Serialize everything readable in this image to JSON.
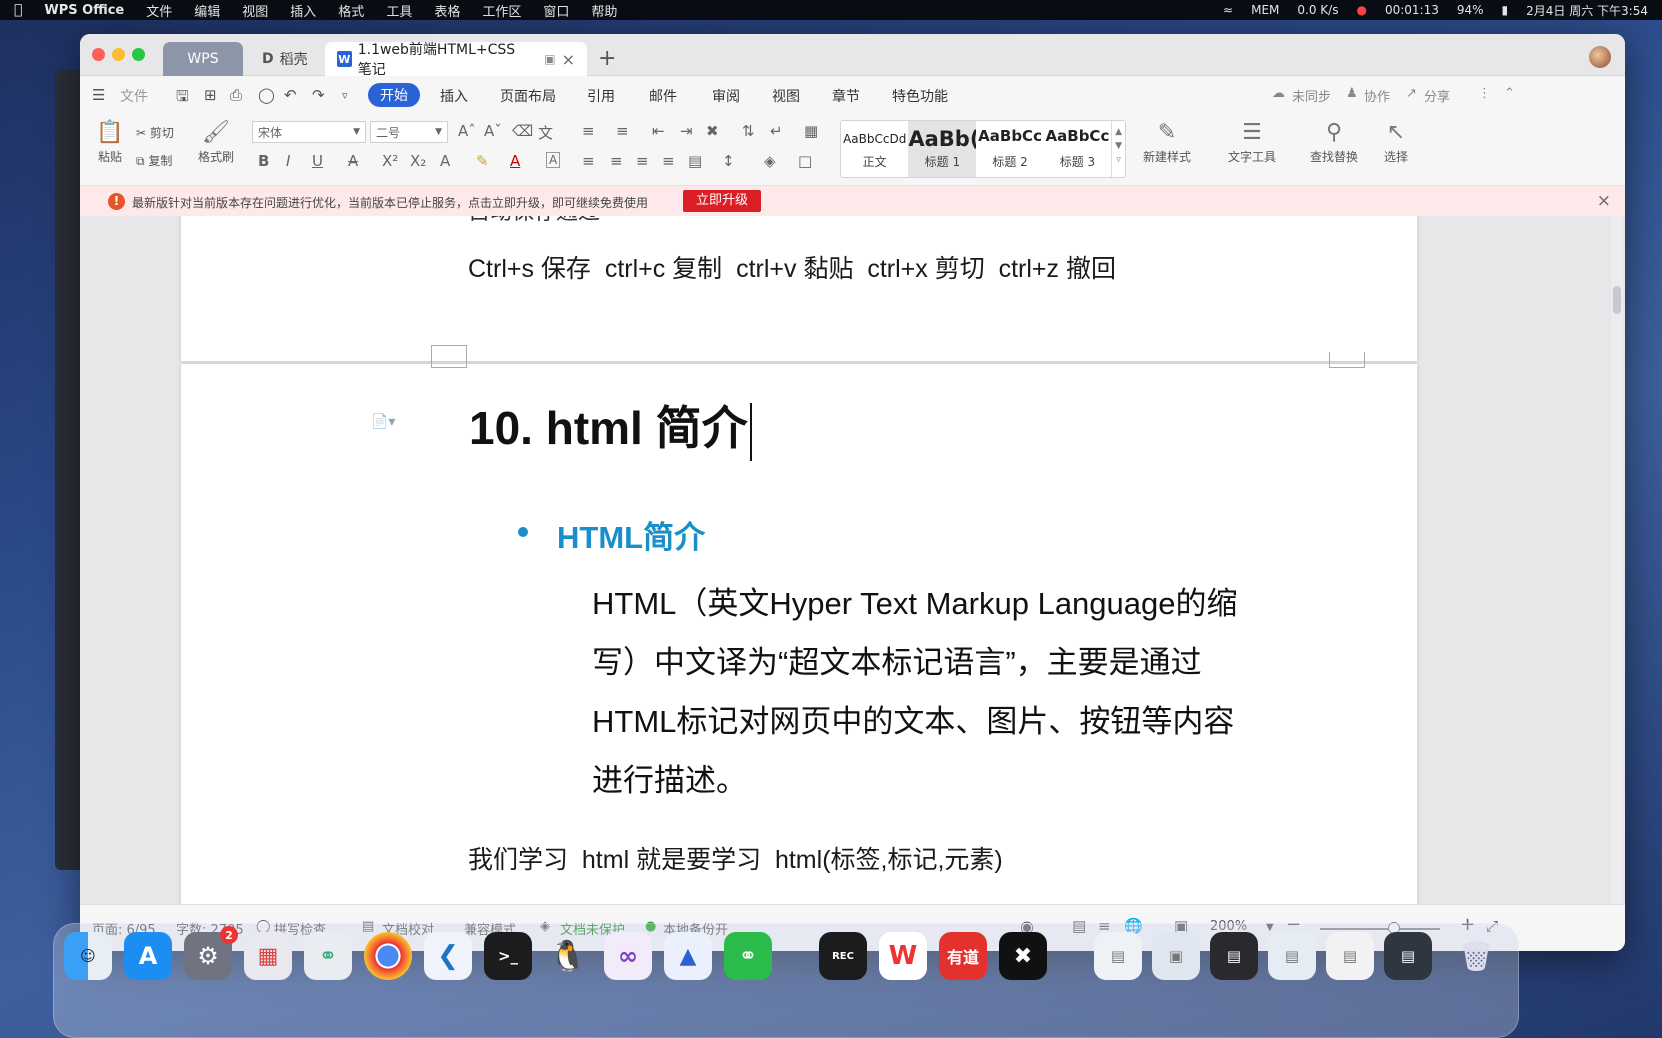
{
  "menubar": {
    "app_name": "WPS Office",
    "items": [
      "文件",
      "编辑",
      "视图",
      "插入",
      "格式",
      "工具",
      "表格",
      "工作区",
      "窗口",
      "帮助"
    ],
    "net": "0.0 K/s",
    "mem": "MEM",
    "record_time": "00:01:13",
    "battery": "94%",
    "datetime": "2月4日 周六 下午3:54"
  },
  "tabs": {
    "wps": "WPS",
    "daoke": "稻壳",
    "doc": "1.1web前端HTML+CSS笔记"
  },
  "menu": {
    "file": "文件",
    "start": "开始",
    "items": [
      "插入",
      "页面布局",
      "引用",
      "邮件",
      "审阅",
      "视图",
      "章节",
      "特色功能"
    ],
    "unsynced": "未同步",
    "collab": "协作",
    "share": "分享"
  },
  "ribbon": {
    "paste": "粘贴",
    "cut": "剪切",
    "copy": "复制",
    "format_painter": "格式刷",
    "font": "宋体",
    "size": "二号",
    "styles": [
      {
        "preview": "AaBbCcDd",
        "label": "正文"
      },
      {
        "preview": "AaBb(",
        "label": "标题 1"
      },
      {
        "preview": "AaBbCc",
        "label": "标题 2"
      },
      {
        "preview": "AaBbCc",
        "label": "标题 3"
      }
    ],
    "new_style": "新建样式",
    "text_tools": "文字工具",
    "find_replace": "查找替换",
    "select": "选择"
  },
  "notice": {
    "message": "最新版针对当前版本存在问题进行优化，当前版本已停止服务，点击立即升级，即可继续免费使用",
    "button": "立即升级"
  },
  "document": {
    "page1_top": "自动保存通过",
    "shortcuts": "Ctrl+s 保存  ctrl+c 复制  ctrl+v 黏贴  ctrl+x 剪切  ctrl+z 撤回",
    "heading": "10. html 简介",
    "subheading": "HTML简介",
    "paragraph": "HTML（英文Hyper Text Markup Language的缩写）中文译为“超文本标记语言”，主要是通过HTML标记对网页中的文本、图片、按钮等内容进行描述。",
    "bottom": "我们学习  html 就是要学习  html(标签,标记,元素)"
  },
  "status": {
    "page": "页面: 6/95",
    "words": "字数: 2705",
    "spell": "拼写检查",
    "proof": "文档校对",
    "compat": "兼容模式",
    "protect": "文档未保护",
    "backup": "本地备份开",
    "zoom": "200%"
  },
  "dock": {
    "record_label": "REC",
    "youdao": "有道",
    "settings_badge": "2"
  }
}
